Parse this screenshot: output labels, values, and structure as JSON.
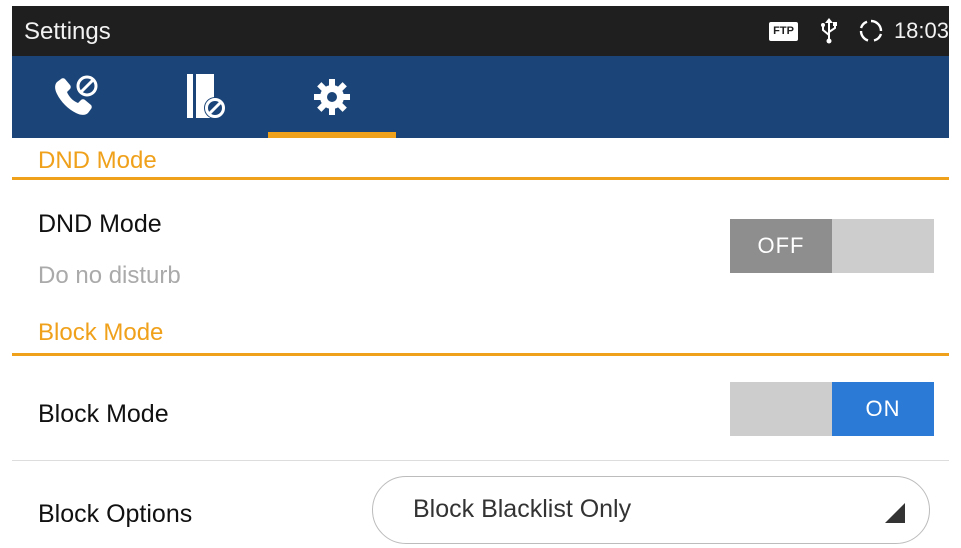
{
  "status_bar": {
    "app_title": "Settings",
    "ftp_badge": "FTP",
    "icons": [
      "usb-icon",
      "sync-icon"
    ],
    "time": "18:03"
  },
  "tabs": [
    {
      "icon": "call-block-icon",
      "selected": false
    },
    {
      "icon": "contacts-block-icon",
      "selected": false
    },
    {
      "icon": "gear-icon",
      "selected": true
    }
  ],
  "sections": {
    "dnd": {
      "header": "DND Mode",
      "item_title": "DND Mode",
      "item_summary": "Do no disturb",
      "toggle": {
        "state": "off",
        "label": "OFF"
      }
    },
    "block": {
      "header": "Block Mode",
      "item_title": "Block Mode",
      "toggle": {
        "state": "on",
        "label": "ON"
      },
      "options_label": "Block Options",
      "options_selected": "Block Blacklist Only"
    }
  },
  "colors": {
    "status_bar": "#1f1f1f",
    "tab_bar": "#1b4578",
    "accent": "#f0a11b",
    "toggle_on": "#2b7ad6",
    "toggle_off": "#8e8e8e"
  }
}
